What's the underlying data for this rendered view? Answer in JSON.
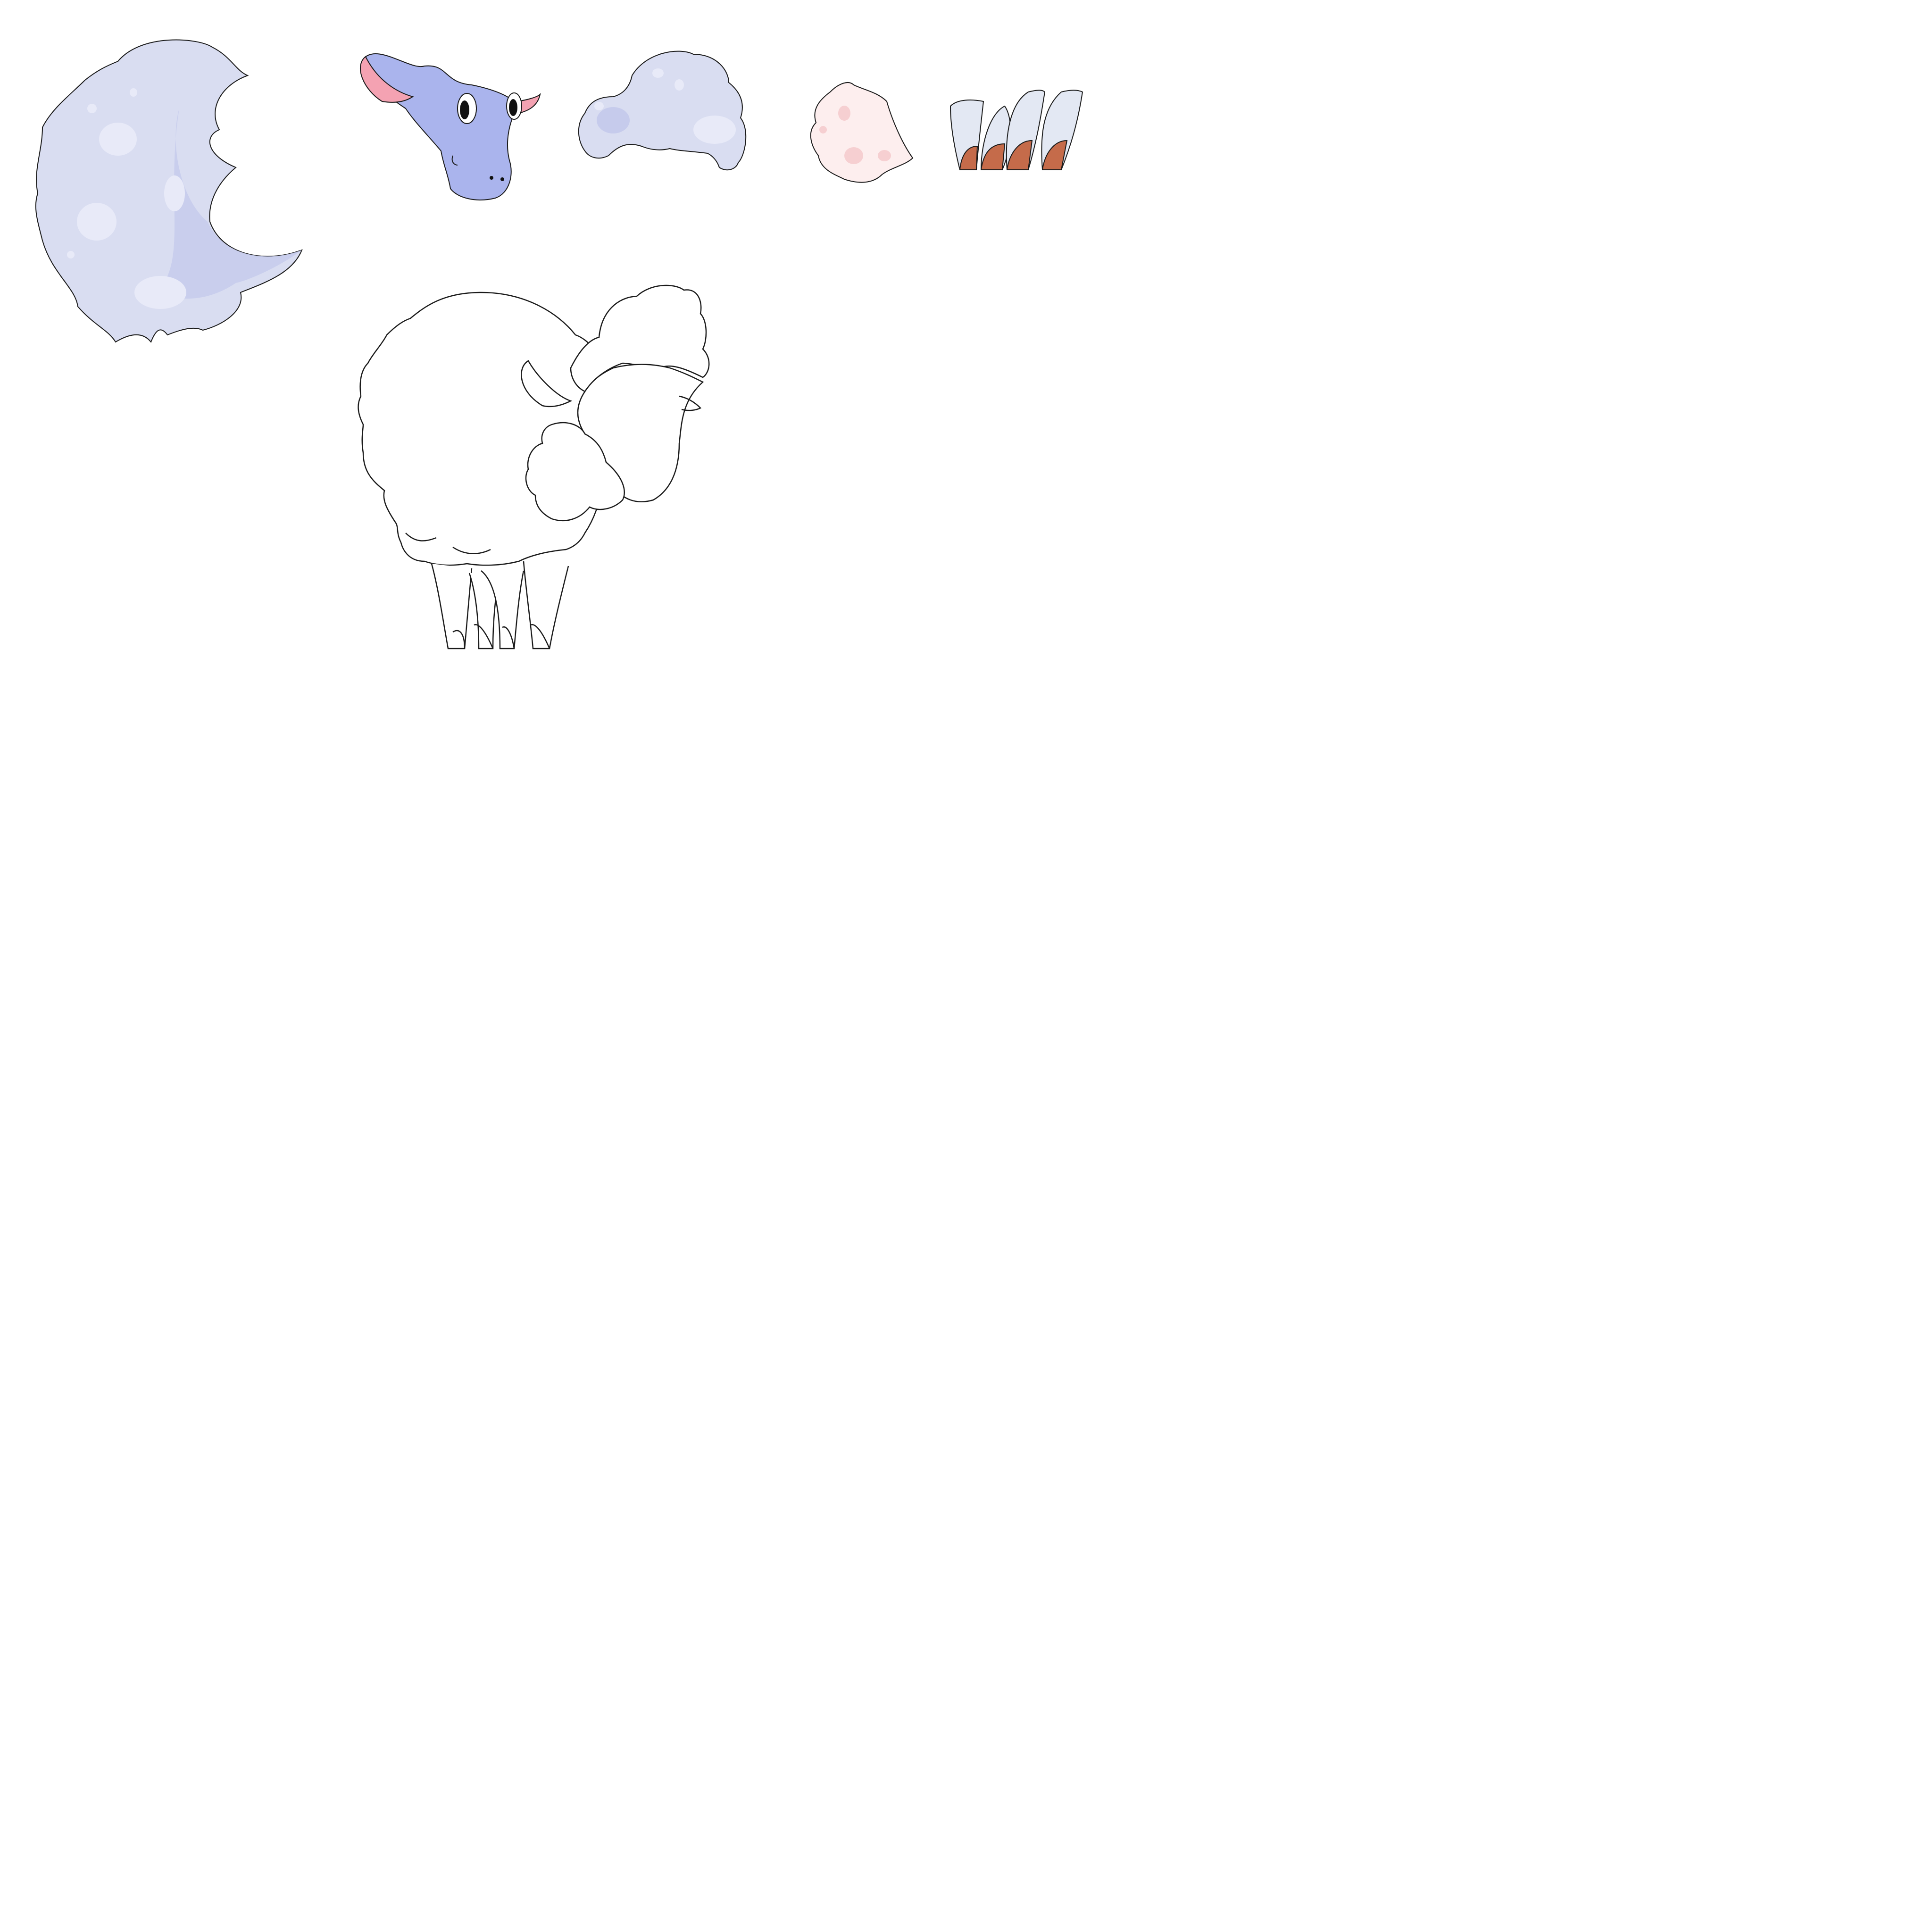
{
  "sprite_sheet": {
    "parts": [
      {
        "name": "sheep-body-wool"
      },
      {
        "name": "sheep-head"
      },
      {
        "name": "sheep-head-wool"
      },
      {
        "name": "sheep-tail"
      },
      {
        "name": "sheep-legs"
      },
      {
        "name": "sheep-outline-assembled"
      }
    ],
    "colors": {
      "wool_fill": "#d9ddf1",
      "wool_shade": "#c6cbec",
      "wool_highlight": "#e8eaf8",
      "face": "#aab4ed",
      "ear_inner": "#f4a2b2",
      "tail_fill": "#fdeeee",
      "tail_spots": "#f6cfd1",
      "hoof": "#c56b4a",
      "leg_fill": "#e3e8f3",
      "stroke": "#1a1a1a",
      "background": "#ffffff"
    }
  }
}
